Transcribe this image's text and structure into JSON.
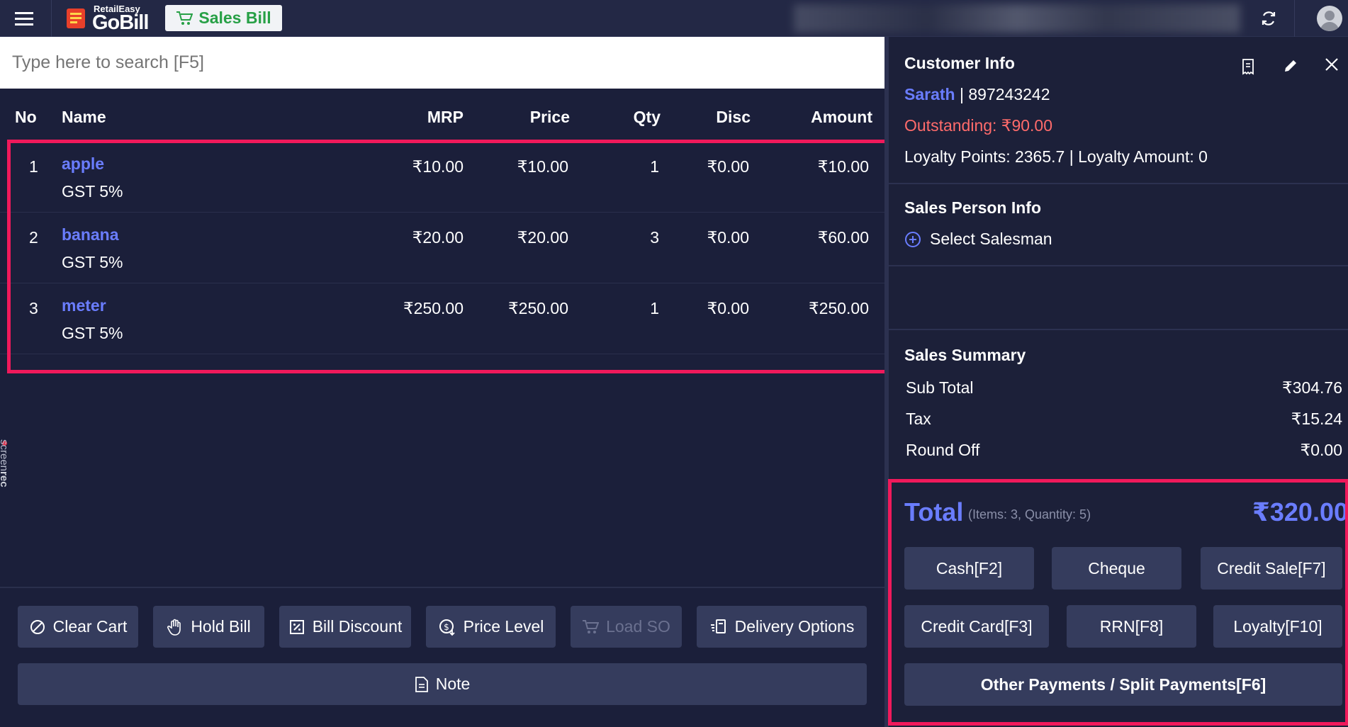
{
  "app": {
    "logo_small": "RetailEasy",
    "logo_big": "GoBill",
    "mode_label": "Sales Bill"
  },
  "search": {
    "placeholder": "Type here to search [F5]"
  },
  "table": {
    "headers": {
      "no": "No",
      "name": "Name",
      "mrp": "MRP",
      "price": "Price",
      "qty": "Qty",
      "disc": "Disc",
      "amount": "Amount"
    },
    "rows": [
      {
        "no": "1",
        "name": "apple",
        "tax": "GST 5%",
        "mrp": "₹10.00",
        "price": "₹10.00",
        "qty": "1",
        "disc": "₹0.00",
        "amount": "₹10.00"
      },
      {
        "no": "2",
        "name": "banana",
        "tax": "GST 5%",
        "mrp": "₹20.00",
        "price": "₹20.00",
        "qty": "3",
        "disc": "₹0.00",
        "amount": "₹60.00"
      },
      {
        "no": "3",
        "name": "meter",
        "tax": "GST 5%",
        "mrp": "₹250.00",
        "price": "₹250.00",
        "qty": "1",
        "disc": "₹0.00",
        "amount": "₹250.00"
      }
    ]
  },
  "actions": {
    "clear_cart": "Clear Cart",
    "hold_bill": "Hold Bill",
    "bill_discount": "Bill Discount",
    "price_level": "Price Level",
    "load_so": "Load SO",
    "delivery_options": "Delivery Options",
    "note": "Note"
  },
  "watermark": {
    "prefix": "screen",
    "suffix": "rec"
  },
  "customer": {
    "title": "Customer Info",
    "name": "Sarath",
    "separator": "|",
    "phone": "897243242",
    "outstanding": "Outstanding: ₹90.00",
    "loyalty": "Loyalty Points: 2365.7 | Loyalty Amount: 0"
  },
  "salesperson": {
    "title": "Sales Person Info",
    "select_label": "Select Salesman"
  },
  "summary": {
    "title": "Sales Summary",
    "subtotal_label": "Sub Total",
    "subtotal_value": "₹304.76",
    "tax_label": "Tax",
    "tax_value": "₹15.24",
    "roundoff_label": "Round Off",
    "roundoff_value": "₹0.00"
  },
  "total": {
    "label": "Total",
    "meta": "(Items: 3, Quantity: 5)",
    "amount": "₹320.00"
  },
  "payments": {
    "cash": "Cash[F2]",
    "cheque": "Cheque",
    "credit_sale": "Credit Sale[F7]",
    "credit_card": "Credit Card[F3]",
    "rrn": "RRN[F8]",
    "loyalty": "Loyalty[F10]",
    "other": "Other Payments / Split Payments[F6]"
  },
  "colors": {
    "background": "#1b1f3a",
    "accent": "#6a7dff",
    "highlight": "#f0195b",
    "outstanding": "#ff6b6b",
    "sales_badge": "#27a046"
  }
}
